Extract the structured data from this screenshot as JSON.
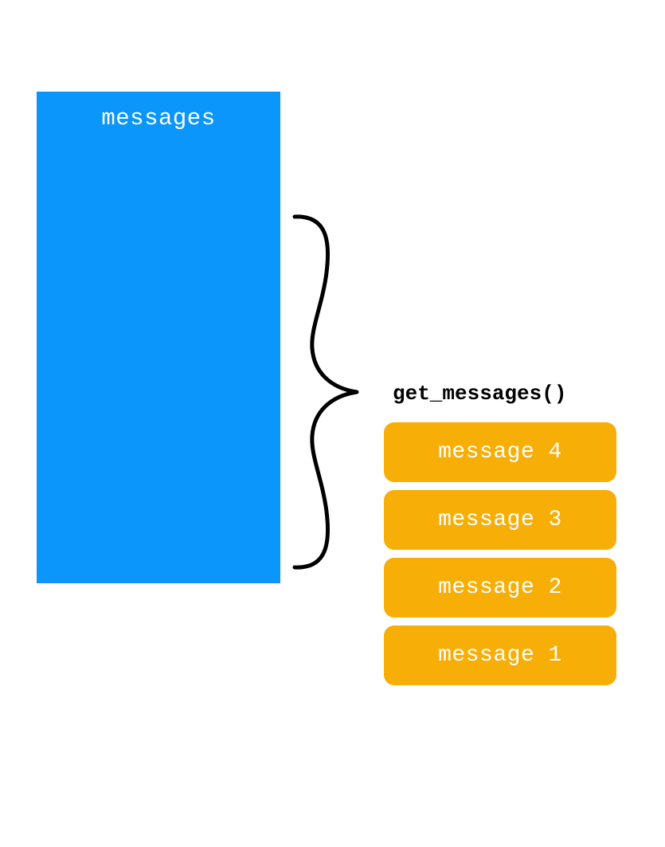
{
  "messages_panel": {
    "label": "messages",
    "color": "#0a96fa"
  },
  "function_label": "get_messages()",
  "message_stack": {
    "color": "#f7ae06",
    "items": [
      {
        "label": "message 4"
      },
      {
        "label": "message 3"
      },
      {
        "label": "message 2"
      },
      {
        "label": "message 1"
      }
    ]
  }
}
